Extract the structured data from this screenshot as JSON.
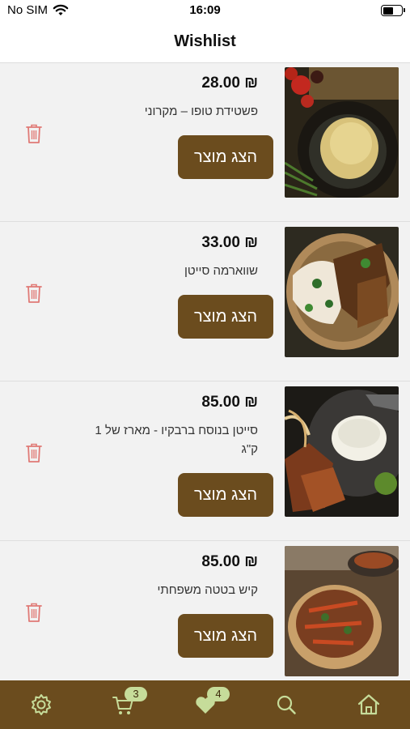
{
  "status_bar": {
    "carrier": "No SIM",
    "time": "16:09"
  },
  "header": {
    "title": "Wishlist"
  },
  "colors": {
    "brand_brown": "#6b4c1e",
    "badge_green": "#c6dc9a",
    "trash_red": "#e07a76"
  },
  "items": [
    {
      "price": "₪ 28.00",
      "name": "פשטידת טופו – מקרוני",
      "button_label": "הצג מוצר"
    },
    {
      "price": "₪ 33.00",
      "name": "שווארמה סייטן",
      "button_label": "הצג מוצר"
    },
    {
      "price": "₪ 85.00",
      "name": "סייטן בנוסח ברבקיו - מארז של 1 ק\"ג",
      "button_label": "הצג מוצר"
    },
    {
      "price": "₪ 85.00",
      "name": "קיש בטטה משפחתי",
      "button_label": "הצג מוצר"
    }
  ],
  "tab_bar": {
    "tabs": [
      "settings-icon",
      "cart-icon",
      "heart-icon",
      "search-icon",
      "home-icon"
    ],
    "cart_badge": "3",
    "wishlist_badge": "4"
  }
}
